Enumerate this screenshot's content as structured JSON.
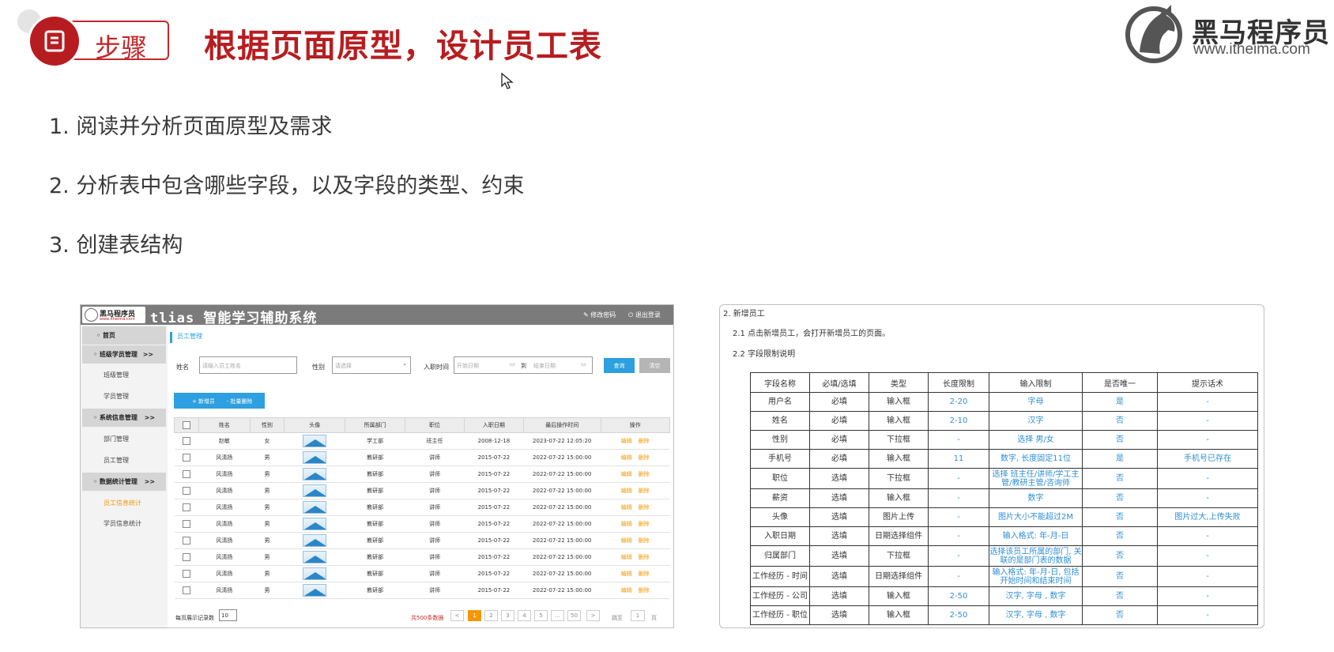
{
  "slide": {
    "badge_label": "步骤",
    "title": "根据页面原型，设计员工表",
    "logo_brand": "黑马程序员",
    "logo_url": "www.itheima.com",
    "steps": [
      "1. 阅读并分析页面原型及需求",
      "2. 分析表中包含哪些字段，以及字段的类型、约束",
      "3. 创建表结构"
    ]
  },
  "prototype": {
    "logo_text": "黑马程序员",
    "logo_sub": "www.itheima.com",
    "system_title": "tlias 智能学习辅助系统",
    "change_pwd": "修改密码",
    "logout": "退出登录",
    "sidebar": {
      "home": "首页",
      "groups": [
        {
          "label": "班级学员管理",
          "arrow": ">>",
          "items": [
            "班级管理",
            "学员管理"
          ]
        },
        {
          "label": "系统信息管理",
          "arrow": ">>",
          "items": [
            "部门管理",
            "员工管理"
          ]
        },
        {
          "label": "数据统计管理",
          "arrow": ">>",
          "items": [
            "员工信息统计",
            "学员信息统计"
          ]
        }
      ]
    },
    "breadcrumb": "员工管理",
    "filters": {
      "name_label": "姓名",
      "name_placeholder": "请输入员工姓名",
      "gender_label": "性别",
      "gender_placeholder": "请选择",
      "date_label": "入职时间",
      "start_placeholder": "开始日期",
      "to_label": "到",
      "end_placeholder": "结束日期",
      "query_button": "查询",
      "clear_button": "清空"
    },
    "add_button": "+ 新增员工",
    "batch_delete_button": "- 批量删除",
    "table": {
      "headers": [
        "姓名",
        "性别",
        "头像",
        "所属部门",
        "职位",
        "入职日期",
        "最后操作时间",
        "操作"
      ],
      "edit_label": "编辑",
      "delete_label": "删除",
      "rows": [
        [
          "赵敏",
          "女",
          "学工部",
          "班主任",
          "2008-12-18",
          "2023-07-22 12:05:20"
        ],
        [
          "风清扬",
          "男",
          "教研部",
          "讲师",
          "2015-07-22",
          "2022-07-22 15:00:00"
        ],
        [
          "风清扬",
          "男",
          "教研部",
          "讲师",
          "2015-07-22",
          "2022-07-22 15:00:00"
        ],
        [
          "风清扬",
          "男",
          "教研部",
          "讲师",
          "2015-07-22",
          "2022-07-22 15:00:00"
        ],
        [
          "风清扬",
          "男",
          "教研部",
          "讲师",
          "2015-07-22",
          "2022-07-22 15:00:00"
        ],
        [
          "风清扬",
          "男",
          "教研部",
          "讲师",
          "2015-07-22",
          "2022-07-22 15:00:00"
        ],
        [
          "风清扬",
          "男",
          "教研部",
          "讲师",
          "2015-07-22",
          "2022-07-22 15:00:00"
        ],
        [
          "风清扬",
          "男",
          "教研部",
          "讲师",
          "2015-07-22",
          "2022-07-22 15:00:00"
        ],
        [
          "风清扬",
          "男",
          "教研部",
          "讲师",
          "2015-07-22",
          "2022-07-22 15:00:00"
        ],
        [
          "风清扬",
          "男",
          "教研部",
          "讲师",
          "2015-07-22",
          "2022-07-22 15:00:00"
        ]
      ]
    },
    "pagination": {
      "per_page_label": "每页展示记录数",
      "per_page_value": "10",
      "total_text": "共500条数据",
      "prev": "<",
      "pages": [
        "1",
        "2",
        "3",
        "4",
        "5",
        "...",
        "50"
      ],
      "current": "1",
      "next": ">",
      "jump_label": "跳至",
      "jump_value": "1",
      "page_unit": "页"
    }
  },
  "spec": {
    "section": "2. 新增员工",
    "sub1": "2.1 点击新增员工，会打开新增员工的页面。",
    "sub2": "2.2 字段限制说明",
    "headers": [
      "字段名称",
      "必填/选填",
      "类型",
      "长度限制",
      "输入限制",
      "是否唯一",
      "提示话术"
    ],
    "rows": [
      [
        "用户名",
        "必填",
        "输入框",
        "2-20",
        "字母",
        "是",
        "-"
      ],
      [
        "姓名",
        "必填",
        "输入框",
        "2-10",
        "汉字",
        "否",
        "-"
      ],
      [
        "性别",
        "必填",
        "下拉框",
        "-",
        "选择 男/女",
        "否",
        "-"
      ],
      [
        "手机号",
        "必填",
        "输入框",
        "11",
        "数字, 长度固定11位",
        "是",
        "手机号已存在"
      ],
      [
        "职位",
        "选填",
        "下拉框",
        "-",
        "选择 班主任/讲师/学工主管/教研主管/咨询师",
        "否",
        "-"
      ],
      [
        "薪资",
        "选填",
        "输入框",
        "-",
        "数字",
        "否",
        "-"
      ],
      [
        "头像",
        "选填",
        "图片上传",
        "-",
        "图片大小不能超过2M",
        "否",
        "图片过大,上传失败"
      ],
      [
        "入职日期",
        "选填",
        "日期选择组件",
        "-",
        "输入格式: 年-月-日",
        "否",
        "-"
      ],
      [
        "归属部门",
        "选填",
        "下拉框",
        "-",
        "选择该员工所属的部门, 关联的是部门表的数据",
        "否",
        "-"
      ],
      [
        "工作经历 - 时间",
        "选填",
        "日期选择组件",
        "-",
        "输入格式: 年-月-日, 包括开始时间和结束时间",
        "否",
        "-"
      ],
      [
        "工作经历 - 公司",
        "选填",
        "输入框",
        "2-50",
        "汉字, 字母 , 数字",
        "否",
        "-"
      ],
      [
        "工作经历 - 职位",
        "选填",
        "输入框",
        "2-50",
        "汉字, 字母 , 数字",
        "否",
        "-"
      ]
    ]
  },
  "colors": {
    "brand_red": "#b71d20",
    "accent_blue": "#2ca0e0",
    "link_orange": "#f39800",
    "spec_blue": "#2e8ed6"
  },
  "icons": [
    "document-icon",
    "cursor-icon",
    "horse-logo-icon",
    "edit-icon",
    "power-icon",
    "calendar-icon",
    "chevron-down-icon"
  ]
}
